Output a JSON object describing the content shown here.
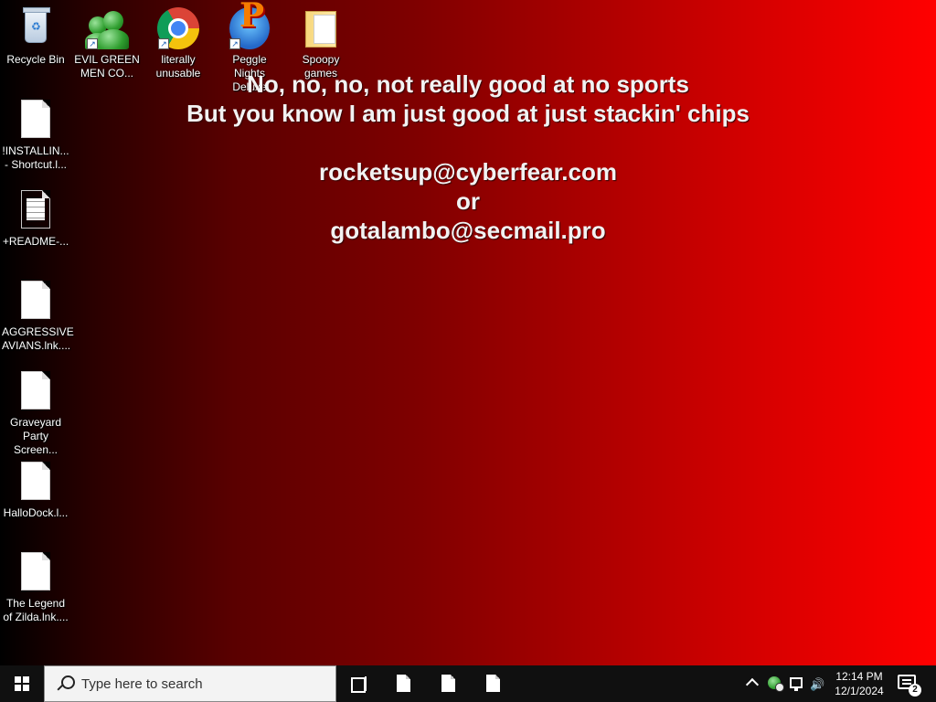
{
  "desktop": {
    "icons": [
      {
        "label": "Recycle Bin",
        "icon": "recycle-bin-icon"
      },
      {
        "label": "EVIL GREEN MEN CO...",
        "icon": "green-men-icon"
      },
      {
        "label": "literally unusable",
        "icon": "chrome-icon"
      },
      {
        "label": "Peggle Nights Deluxe",
        "icon": "peggle-icon"
      },
      {
        "label": "Spoopy games",
        "icon": "folder-icon"
      },
      {
        "label": "!INSTALLIN... - Shortcut.l...",
        "icon": "file-icon"
      },
      {
        "label": "+README-...",
        "icon": "text-file-icon"
      },
      {
        "label": "AGGRESSIVE AVIANS.lnk....",
        "icon": "file-icon"
      },
      {
        "label": "Graveyard Party Screen...",
        "icon": "file-icon"
      },
      {
        "label": "HalloDock.l...",
        "icon": "file-icon"
      },
      {
        "label": "The Legend of Zilda.lnk....",
        "icon": "file-icon"
      }
    ]
  },
  "note": {
    "line1": "No, no, no, not really good at no sports",
    "line2": "But you know I am just good at just stackin' chips",
    "email1": "rocketsup@cyberfear.com",
    "or": "or",
    "email2": "gotalambo@secmail.pro"
  },
  "taskbar": {
    "search_placeholder": "Type here to search",
    "apps": [
      "file-icon",
      "file-icon",
      "file-icon"
    ],
    "time": "12:14 PM",
    "date": "12/1/2024",
    "notification_count": "2"
  },
  "colors": {
    "gradient_left": "#000000",
    "gradient_right": "#ff0000",
    "taskbar": "#101010"
  }
}
